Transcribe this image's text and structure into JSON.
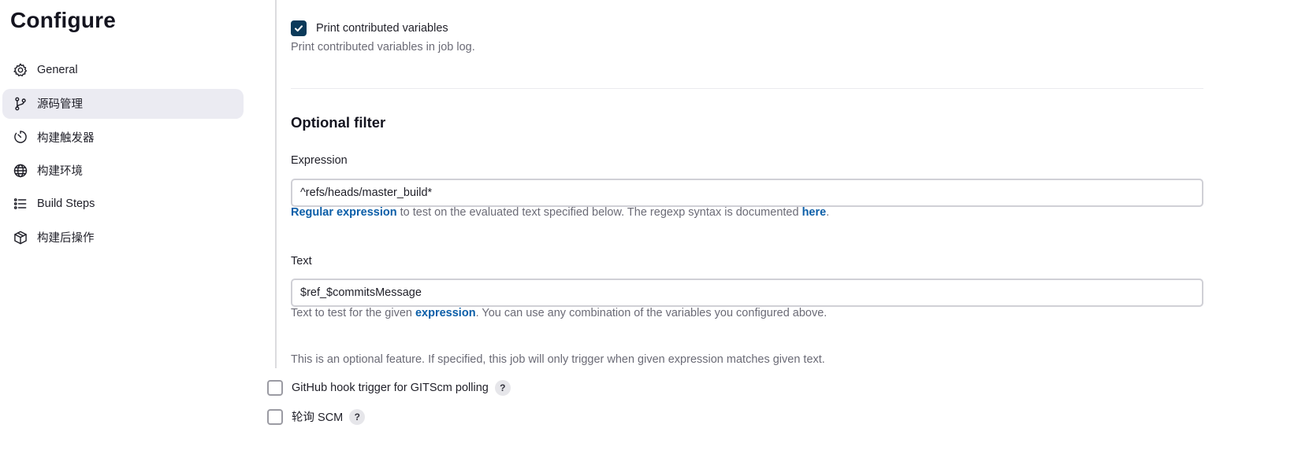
{
  "page": {
    "title": "Configure"
  },
  "sidebar": {
    "items": [
      {
        "label": "General",
        "icon": "gear-icon",
        "active": false
      },
      {
        "label": "源码管理",
        "icon": "branch-icon",
        "active": true
      },
      {
        "label": "构建触发器",
        "icon": "timer-icon",
        "active": false
      },
      {
        "label": "构建环境",
        "icon": "globe-icon",
        "active": false
      },
      {
        "label": "Build Steps",
        "icon": "list-icon",
        "active": false
      },
      {
        "label": "构建后操作",
        "icon": "package-icon",
        "active": false
      }
    ]
  },
  "print_vars": {
    "checked": true,
    "label": "Print contributed variables",
    "help": "Print contributed variables in job log."
  },
  "optional_filter": {
    "title": "Optional filter",
    "expression": {
      "label": "Expression",
      "value": "^refs/heads/master_build*",
      "help_link1": "Regular expression",
      "help_mid": " to test on the evaluated text specified below. The regexp syntax is documented ",
      "help_link2": "here",
      "help_end": "."
    },
    "text": {
      "label": "Text",
      "value": "$ref_$commitsMessage",
      "help_start": "Text to test for the given ",
      "help_link": "expression",
      "help_end": ". You can use any combination of the variables you configured above."
    },
    "note": "This is an optional feature. If specified, this job will only trigger when given expression matches given text."
  },
  "triggers": [
    {
      "label": "GitHub hook trigger for GITScm polling",
      "checked": false,
      "help": "?"
    },
    {
      "label": "轮询 SCM",
      "checked": false,
      "help": "?"
    }
  ],
  "colors": {
    "accent": "#0b3a5a",
    "link": "#0b5ea8",
    "active_bg": "#ebebf2"
  }
}
